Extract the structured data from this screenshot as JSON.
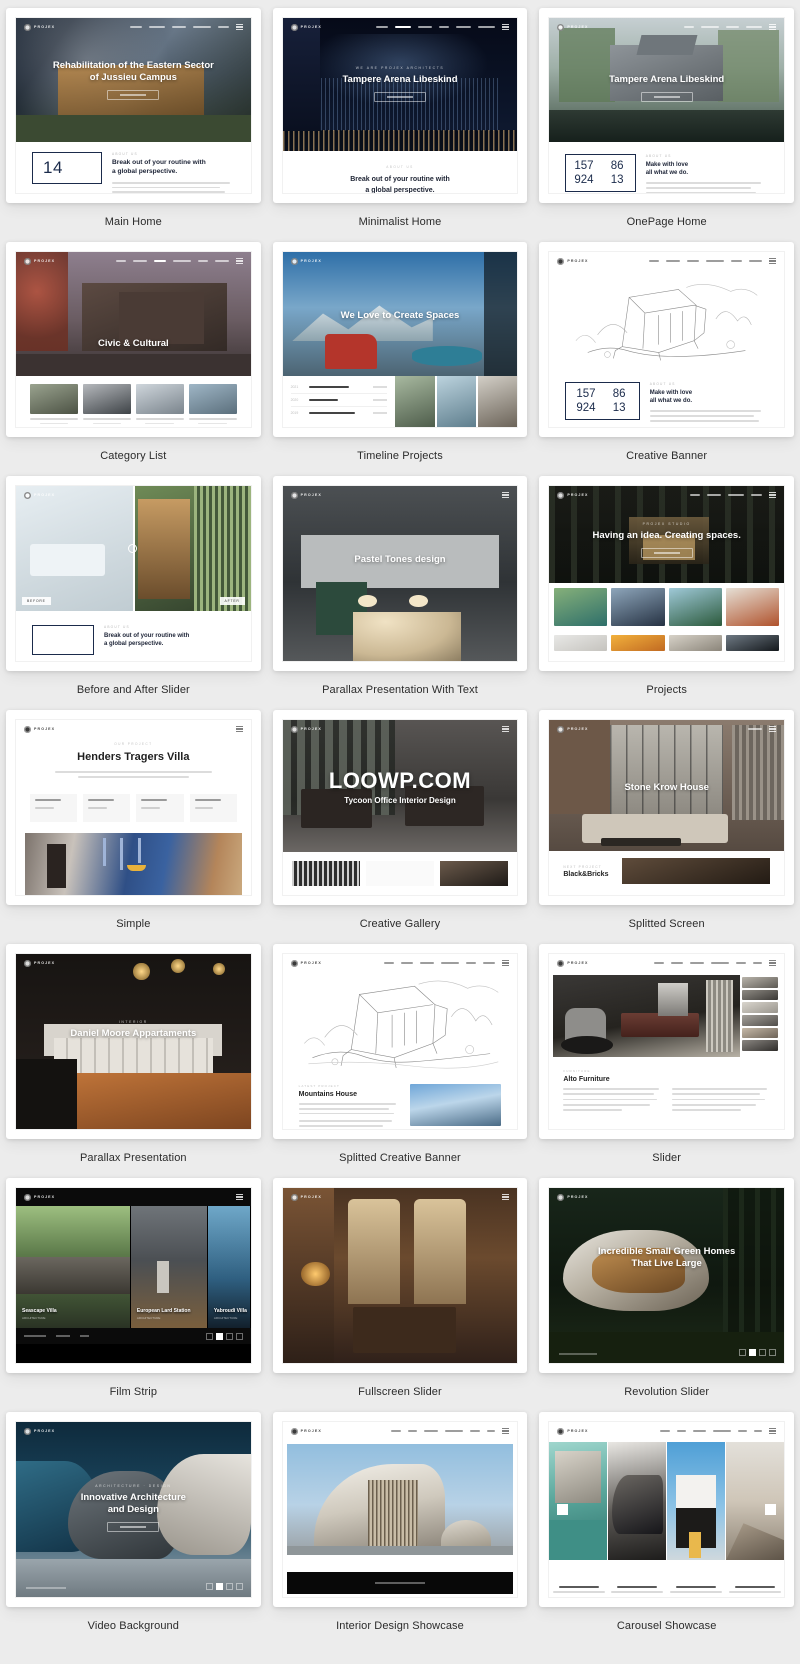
{
  "page": {
    "watermark": "LOOWP.COM",
    "brand": "PROJEX"
  },
  "demos": [
    {
      "label": "Main Home",
      "hero_title": "Rehabilitation of the Eastern Sector\nof Jussieu Campus",
      "hero_line1": "Rehabilitation of the Eastern Sector",
      "hero_line2": "of Jussieu Campus",
      "eyebrow": "",
      "counter": "14",
      "copy_kicker": "ABOUT US",
      "copy_heading_1": "Break out of your routine with",
      "copy_heading_2": "a global perspective."
    },
    {
      "label": "Minimalist Home",
      "hero_line1": "Tampere Arena Libeskind",
      "hero_line2": "",
      "eyebrow": "WE ARE PROJEX ARCHITECTS",
      "copy_kicker": "ABOUT US",
      "copy_heading_1": "Break out of your routine with",
      "copy_heading_2": "a global perspective."
    },
    {
      "label": "OnePage Home",
      "hero_line1": "Tampere Arena Libeskind",
      "hero_line2": "",
      "stats": [
        "157",
        "86",
        "924",
        "13"
      ],
      "copy_kicker": "ABOUT US",
      "copy_heading_1": "Make with love",
      "copy_heading_2": "all what we do."
    },
    {
      "label": "Category List",
      "hero_line1": "Civic & Cultural",
      "hero_line2": ""
    },
    {
      "label": "Timeline Projects",
      "hero_line1": "We Love to Create Spaces",
      "hero_line2": "",
      "timeline_rows": [
        {
          "year": "2021",
          "name": "Seascape Villa"
        },
        {
          "year": "2020",
          "name": "Blu Hotel"
        },
        {
          "year": "2019",
          "name": "Gaudin Bar Villa"
        }
      ]
    },
    {
      "label": "Creative Banner",
      "stats": [
        "157",
        "86",
        "924",
        "13"
      ],
      "copy_kicker": "ABOUT US",
      "copy_heading_1": "Make with love",
      "copy_heading_2": "all what we do."
    },
    {
      "label": "Before and After Slider",
      "before_label": "BEFORE",
      "after_label": "AFTER",
      "copy_kicker": "ABOUT US",
      "copy_heading_1": "Break out of your routine with",
      "copy_heading_2": "a global perspective."
    },
    {
      "label": "Parallax Presentation With Text",
      "hero_line1": "Pastel Tones design",
      "hero_line2": ""
    },
    {
      "label": "Projects",
      "hero_line1": "Having an idea. Creating spaces.",
      "hero_line2": "",
      "eyebrow": "PROJEX STUDIO"
    },
    {
      "label": "Simple",
      "kicker": "OUR PROJECT",
      "title": "Henders Tragers Villa"
    },
    {
      "label": "Creative Gallery",
      "hero_line1": "LOOWP.COM",
      "hero_line2": "Tycoon Office Interior Design"
    },
    {
      "label": "Splitted Screen",
      "hero_line1": "Stone Krow House",
      "hero_line2": "",
      "bottom_kicker": "NEXT PROJECT",
      "bottom_title": "Black&Bricks"
    },
    {
      "label": "Parallax Presentation",
      "hero_line1": "Daniel Moore Appartaments",
      "hero_line2": "",
      "eyebrow": "INTERIOR"
    },
    {
      "label": "Splitted Creative Banner",
      "kicker": "LATEST PROJECT",
      "title": "Mountains House"
    },
    {
      "label": "Slider",
      "kicker": "FURNITURE",
      "title": "Alto Furniture"
    },
    {
      "label": "Film Strip",
      "panes": [
        {
          "title": "Seascape Villa",
          "sub": "ARCHITECTURE"
        },
        {
          "title": "European Lard Station",
          "sub": "ARCHITECTURE"
        },
        {
          "title": "Yabroudi Villa",
          "sub": "ARCHITECTURE"
        }
      ],
      "foot_links": [
        "SEASCAPE VILLA",
        "CATEGORY",
        "2021"
      ],
      "page_current": "1"
    },
    {
      "label": "Fullscreen Slider"
    },
    {
      "label": "Revolution Slider",
      "hero_line1": "Incredible Small Green Homes",
      "hero_line2": "That Live Large",
      "page_current": "2"
    },
    {
      "label": "Video Background",
      "hero_line1": "Innovative Architecture",
      "hero_line2": "and Design",
      "eyebrow": "ARCHITECTURE  ·  DESIGN"
    },
    {
      "label": "Interior Design Showcase"
    },
    {
      "label": "Carousel Showcase",
      "items": [
        {
          "title": "seascape villa",
          "sub": "architecture"
        },
        {
          "title": "european lard station",
          "sub": "architecture"
        },
        {
          "title": "yabroudi villa",
          "sub": "architecture"
        },
        {
          "title": "national complex center",
          "sub": "architecture"
        }
      ]
    }
  ]
}
